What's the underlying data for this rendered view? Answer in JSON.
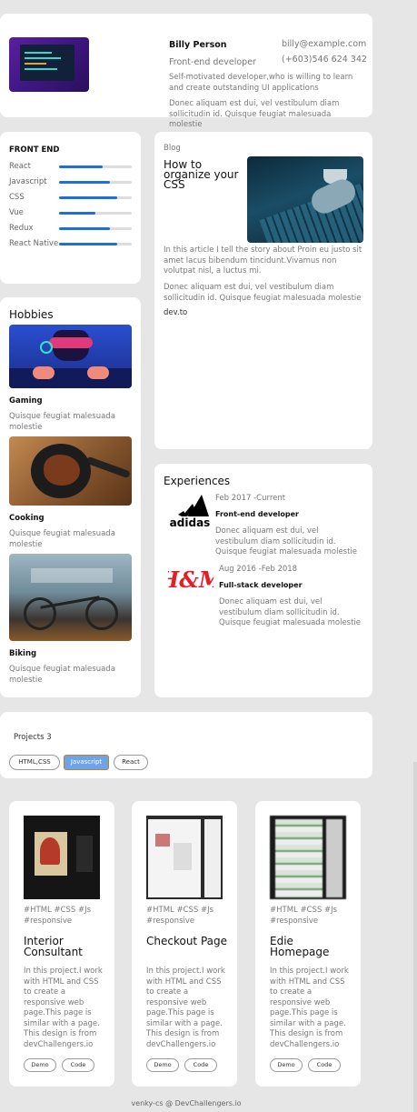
{
  "profile": {
    "name": "Billy Person",
    "role": "Front-end developer",
    "email": "billy@example.com",
    "phone": "(+603)546 624 342",
    "bio": "Self-motivated developer,who is willing to learn and create outstanding UI applications",
    "bio2": "Donec aliquam est dui, vel vestibulum diam sollicitudin id. Quisque feugiat malesuada molestie"
  },
  "skills": {
    "title": "FRONT END",
    "items": [
      {
        "label": "React",
        "level": 0.6
      },
      {
        "label": "Javascript",
        "level": 0.7
      },
      {
        "label": "CSS",
        "level": 0.8
      },
      {
        "label": "Vue",
        "level": 0.5
      },
      {
        "label": "Redux",
        "level": 0.7
      },
      {
        "label": "React Native",
        "level": 0.8
      }
    ],
    "accent": "#1d6fdc"
  },
  "blog": {
    "tag": "Blog",
    "title": "How to organize your CSS",
    "p1": "In this article I tell the story about Proin eu justo sit amet lacus bibendum tincidunt.Vivamus non volutpat nisl, a luctus mi.",
    "p2": "Donec aliquam est dui, vel vestibulum diam sollicitudin id. Quisque feugiat malesuada molestie",
    "link": "dev.to"
  },
  "hobbies": {
    "title": "Hobbies",
    "items": [
      {
        "name": "Gaming",
        "desc": "Quisque feugiat malesuada molestie"
      },
      {
        "name": "Cooking",
        "desc": "Quisque feugiat malesuada molestie"
      },
      {
        "name": "Biking",
        "desc": "Quisque feugiat malesuada molestie"
      }
    ]
  },
  "experiences": {
    "title": "Experiences",
    "items": [
      {
        "company": "adidas",
        "date": "Feb 2017 -Current",
        "role": "Front-end developer",
        "desc": "Donec aliquam est dui, vel vestibulum diam sollicitudin id. Quisque feugiat malesuada molestie"
      },
      {
        "company": "H&M",
        "date": "Aug 2016 -Feb 2018",
        "role": "Full-stack developer",
        "desc": "Donec aliquam est dui, vel vestibulum diam sollicitudin id. Quisque feugiat malesuada molestie"
      }
    ]
  },
  "projects": {
    "title": "Projects 3",
    "filters": [
      "HTML,CSS",
      "Javascript",
      "React"
    ],
    "active_filter": "Javascript",
    "items": [
      {
        "tags": "#HTML #CSS #Js #responsive",
        "title": "Interior Consultant",
        "desc": "In this project.I work with HTML and CSS to create a responsive web page.This page is similar with a page. This design is from devChallengers.io",
        "demo": "Demo",
        "code": "Code"
      },
      {
        "tags": "#HTML #CSS #Js #responsive",
        "title": "Checkout Page",
        "desc": "In this project.I work with HTML and CSS to create a responsive web page.This page is similar with a page. This design is from devChallengers.io",
        "demo": "Demo",
        "code": "Code"
      },
      {
        "tags": "#HTML #CSS #Js #responsive",
        "title": "Edie Homepage",
        "desc": "In this project.I work with HTML and CSS to create a responsive web page.This page is similar with a page. This design is from devChallengers.io",
        "demo": "Demo",
        "code": "Code"
      }
    ]
  },
  "footer": "venky-cs @ DevChallengers.io",
  "colors": {
    "background": "#e6e6e6",
    "card": "#ffffff",
    "hm_red": "#e41e26"
  }
}
